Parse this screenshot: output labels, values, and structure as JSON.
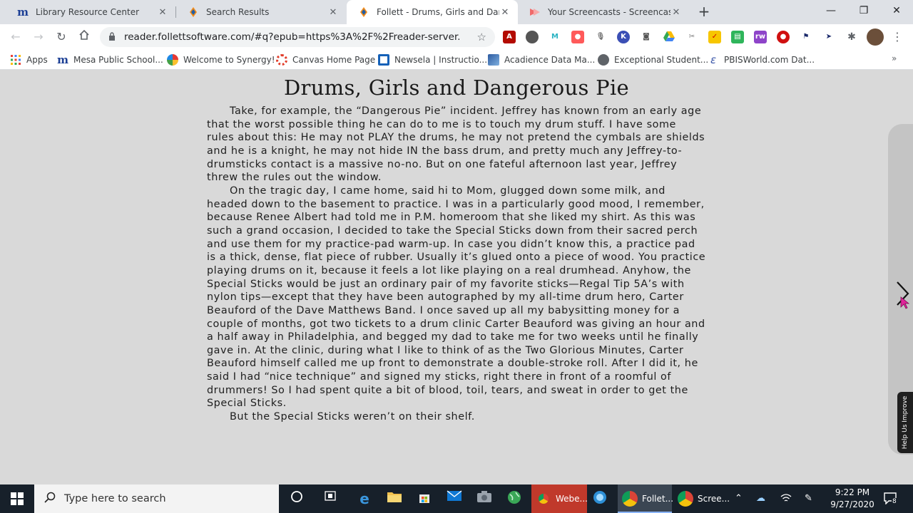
{
  "browser": {
    "tabs": [
      {
        "title": "Library Resource Center",
        "icon": "mesa-m-icon",
        "active": false
      },
      {
        "title": "Search Results",
        "icon": "follett-icon",
        "active": false
      },
      {
        "title": "Follett - Drums, Girls and Dangerous Pie",
        "icon": "follett-icon",
        "active": true
      },
      {
        "title": "Your Screencasts - Screencastify",
        "icon": "screencastify-icon",
        "active": false
      }
    ],
    "url": "reader.follettsoftware.com/#q?epub=https%3A%2F%2Freader-server.follett...",
    "bookmarks": [
      {
        "label": "Apps",
        "icon": "apps-grid-icon"
      },
      {
        "label": "Mesa Public School...",
        "icon": "mesa-m-icon"
      },
      {
        "label": "Welcome to Synergy!",
        "icon": "synergy-icon"
      },
      {
        "label": "Canvas Home Page",
        "icon": "canvas-icon"
      },
      {
        "label": "Newsela | Instructio...",
        "icon": "newsela-icon"
      },
      {
        "label": "Acadience Data Ma...",
        "icon": "acadience-icon"
      },
      {
        "label": "Exceptional Student...",
        "icon": "globe-icon"
      },
      {
        "label": "PBISWorld.com Dat...",
        "icon": "pbisworld-icon"
      }
    ],
    "bookmarks_more": "»"
  },
  "reader": {
    "title": "Drums, Girls and Dangerous Pie",
    "paragraphs": [
      "Take, for example, the “Dangerous Pie” incident. Jeffrey has known from an early age that the worst possible thing he can do to me is to touch my drum stuff. I have some rules about this: He may not PLAY the drums, he may not pretend the cymbals are shields and he is a knight, he may not hide IN the bass drum, and pretty much any Jeffrey-to-drumsticks contact is a massive no-no. But on one fateful afternoon last year, Jeffrey threw the rules out the window.",
      "On the tragic day, I came home, said hi to Mom, glugged down some milk, and headed down to the basement to practice. I was in a particularly good mood, I remember, because Renee Albert had told me in P.M. homeroom that she liked my shirt. As this was such a grand occasion, I decided to take the Special Sticks down from their sacred perch and use them for my practice-pad warm-up. In case you didn’t know this, a practice pad is a thick, dense, flat piece of rubber. Usually it’s glued onto a piece of wood. You practice playing drums on it, because it feels a lot like playing on a real drumhead. Anyhow, the Special Sticks would be just an ordinary pair of my favorite sticks—Regal Tip 5A’s with nylon tips—except that they have been autographed by my all-time drum hero, Carter Beauford of the Dave Matthews Band. I once saved up all my babysitting money for a couple of months, got two tickets to a drum clinic Carter Beauford was giving an hour and a half away in Philadelphia, and begged my dad to take me for two weeks until he finally gave in. At the clinic, during what I like to think of as the Two Glorious Minutes, Carter Beauford himself called me up front to demonstrate a double-stroke roll. After I did it, he said I had “nice technique” and signed my sticks, right there in front of a roomful of drummers! So I had spent quite a bit of blood, toil, tears, and sweat in order to get the Special Sticks.",
      "But the Special Sticks weren’t on their shelf."
    ],
    "help_tab": "Help Us Improve"
  },
  "taskbar": {
    "search_placeholder": "Type here to search",
    "apps": [
      {
        "label": "Webe...",
        "icon": "chrome-icon",
        "badge": "1"
      },
      {
        "label": "Follet...",
        "icon": "chrome-icon",
        "active": true
      },
      {
        "label": "Scree...",
        "icon": "chrome-icon"
      }
    ],
    "time": "9:22 PM",
    "date": "9/27/2020",
    "notification_count": "8"
  },
  "colors": {
    "reader_bg": "#d9d9d9",
    "tabstrip_bg": "#dee1e6",
    "taskbar_bg": "#17202a",
    "follett_orange": "#f28c1b",
    "follett_blue": "#1f5fa8",
    "mesa_blue": "#1c3f95"
  }
}
